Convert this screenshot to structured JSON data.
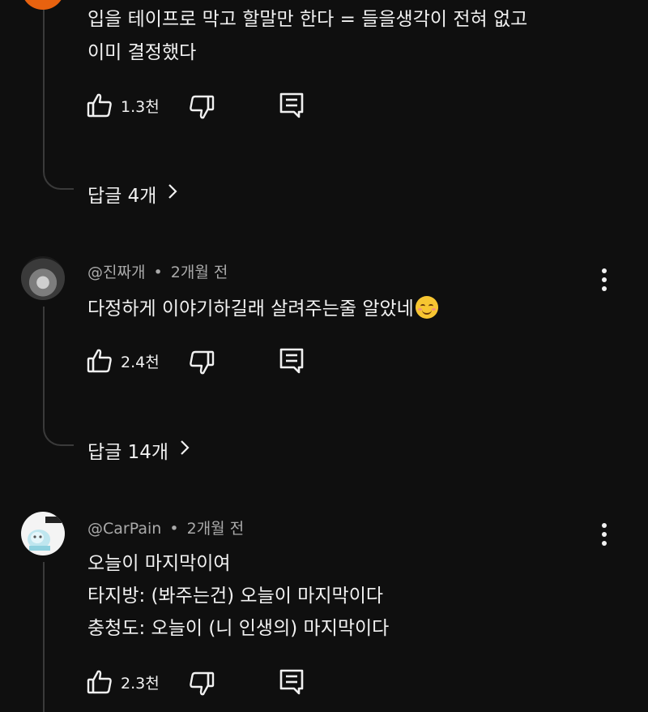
{
  "comments": [
    {
      "author": "",
      "time": "",
      "lines": [
        "입을 테이프로 막고 할말만 한다 = 들을생각이 전혀 없고",
        "이미 결정했다"
      ],
      "likes": "1.3천",
      "replies": "답글 4개"
    },
    {
      "author": "@진짜개",
      "time": "2개월 전",
      "lines": [
        "다정하게 이야기하길래 살려주는줄 알았네"
      ],
      "likes": "2.4천",
      "replies": "답글 14개"
    },
    {
      "author": "@CarPain",
      "time": "2개월 전",
      "lines": [
        "오늘이 마지막이여",
        "타지방: (봐주는건) 오늘이 마지막이다",
        "충청도: 오늘이 (니 인생의) 마지막이다"
      ],
      "likes": "2.3천"
    }
  ],
  "separator": "•",
  "icons": {
    "like": "thumbs-up-icon",
    "dislike": "thumbs-down-icon",
    "reply": "reply-comment-icon",
    "more": "more-vertical-icon",
    "chevron": "chevron-right-icon",
    "emoji": "smiling-face-emoji"
  },
  "colors": {
    "background": "#0f0f0f",
    "text": "#f1f1f1",
    "meta": "#aaaaaa",
    "thread": "#3a3a3a",
    "avatar_orange": "#e8620f"
  }
}
